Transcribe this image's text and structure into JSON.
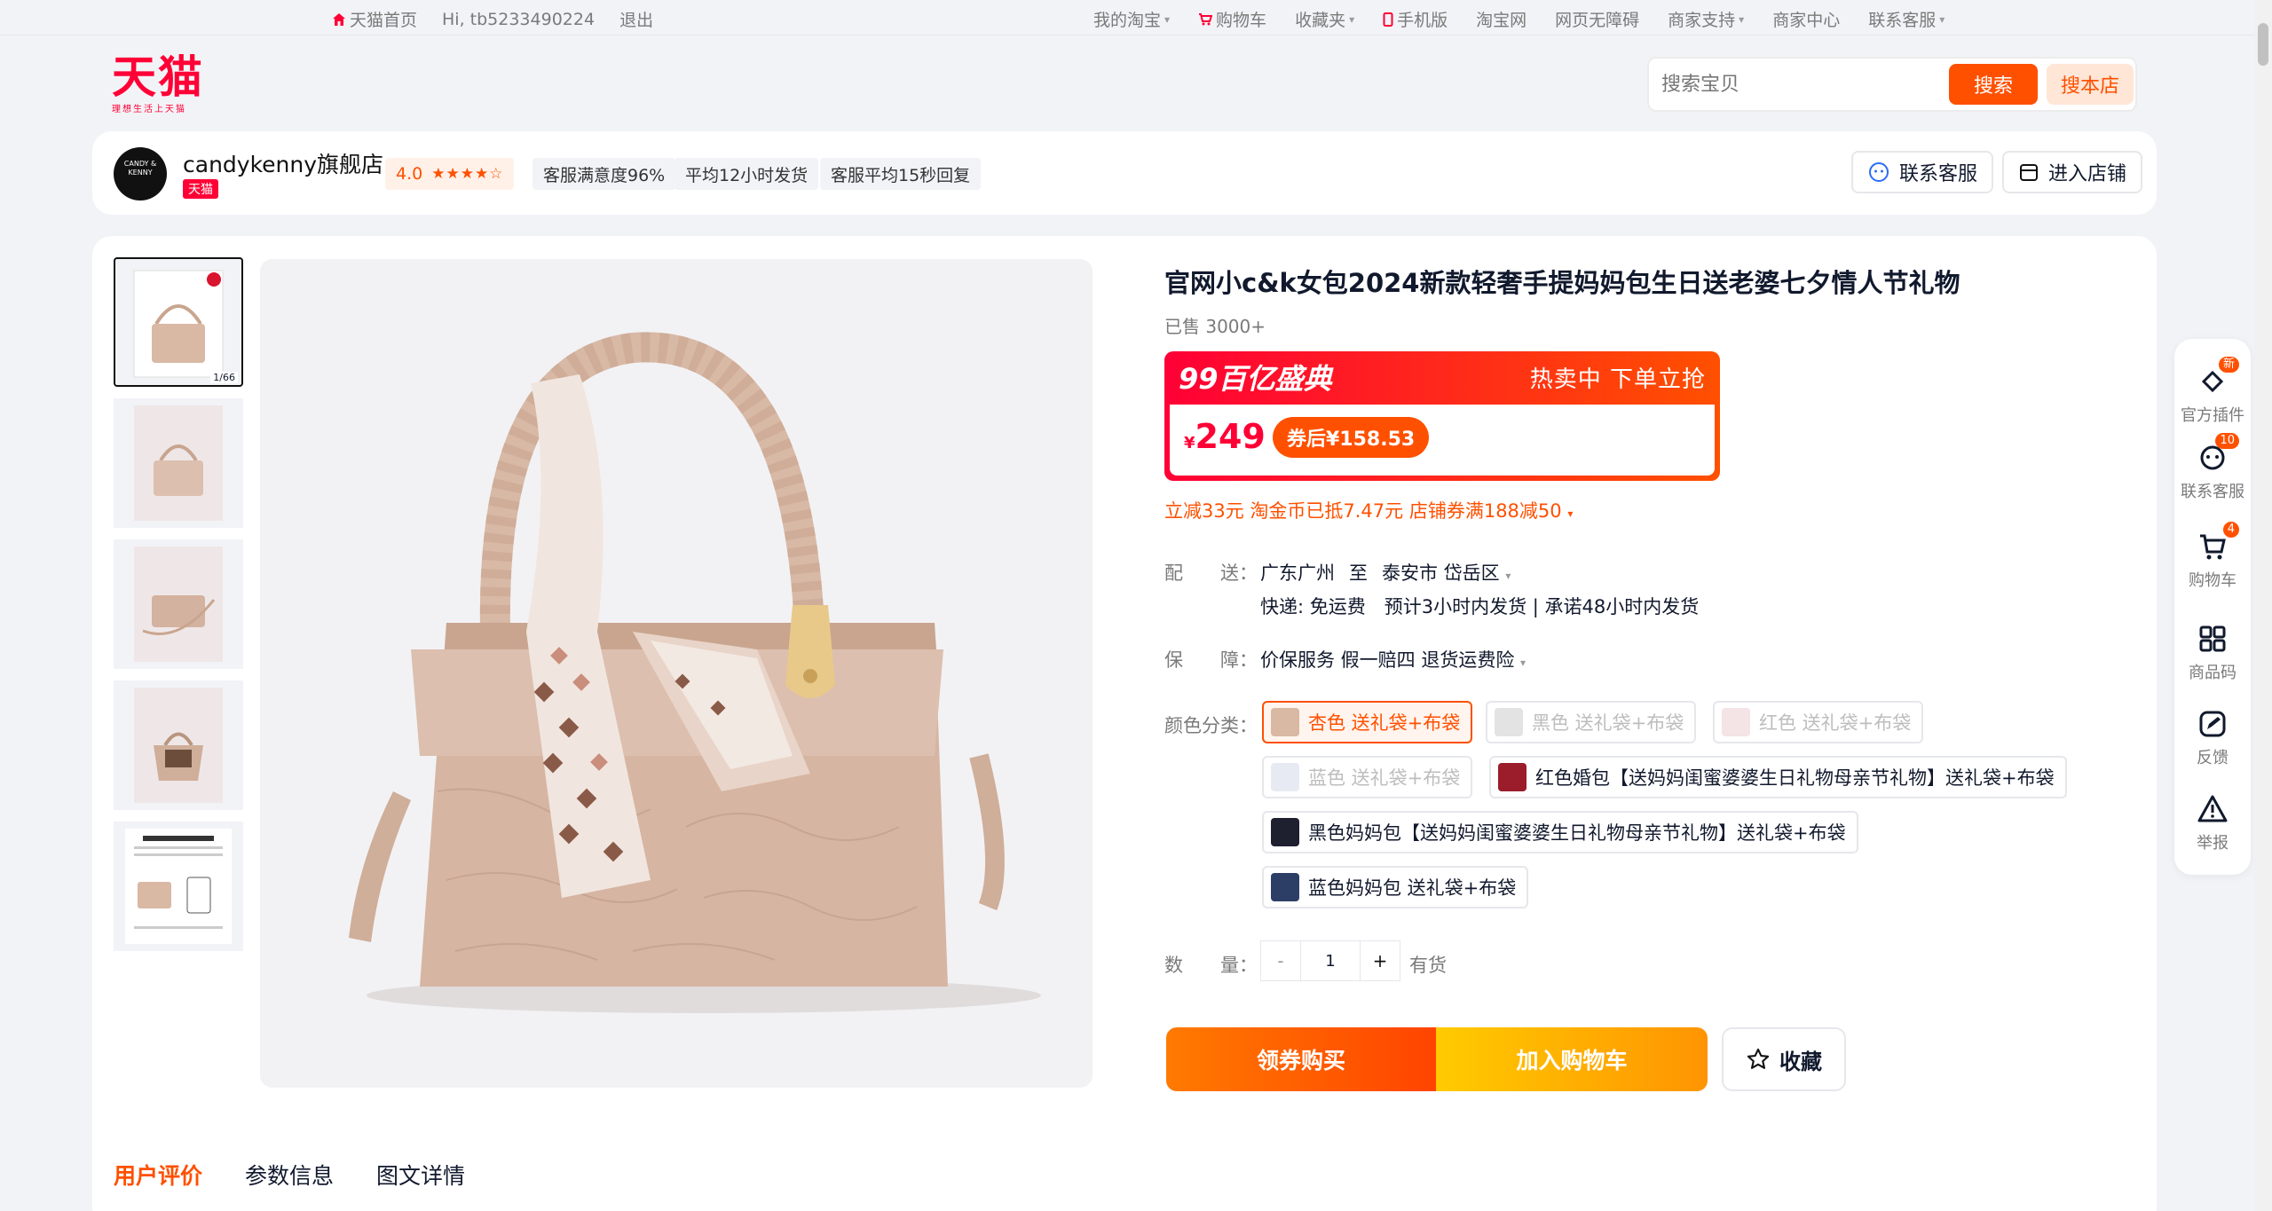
{
  "topbar": {
    "left": [
      "天猫首页",
      "Hi, tb5233490224",
      "退出"
    ],
    "right": [
      {
        "label": "我的淘宝",
        "caret": true
      },
      {
        "label": "购物车",
        "caret": false
      },
      {
        "label": "收藏夹",
        "caret": true
      },
      {
        "label": "手机版",
        "caret": false
      },
      {
        "label": "淘宝网",
        "caret": false
      },
      {
        "label": "网页无障碍",
        "caret": false
      },
      {
        "label": "商家支持",
        "caret": true
      },
      {
        "label": "商家中心",
        "caret": false
      },
      {
        "label": "联系客服",
        "caret": true
      }
    ]
  },
  "logo": {
    "text": "天猫",
    "slogan": "理想生活上天猫"
  },
  "search": {
    "placeholder": "搜索宝贝",
    "btn_search": "搜索",
    "btn_shop": "搜本店"
  },
  "shop": {
    "avatar_text": "CANDY & KENNY",
    "name": "candykenny旗舰店",
    "badge": "天猫",
    "rating": "4.0",
    "stars": "★★★★☆",
    "tags": [
      "客服满意度96%",
      "平均12小时发货",
      "客服平均15秒回复"
    ],
    "btn_service": "联系客服",
    "btn_enter": "进入店铺"
  },
  "thumbs": {
    "count_label": "1/66"
  },
  "product": {
    "title": "官网小c&k女包2024新款轻奢手提妈妈包生日送老婆七夕情人节礼物",
    "sold": "已售 3000+",
    "promo_title": "99百亿盛典",
    "promo_right": "热卖中 下单立抢",
    "yen": "¥",
    "price": "249",
    "coupon_price": "券后¥158.53",
    "discounts": "立减33元 淘金币已抵7.47元 店铺券满188减50"
  },
  "delivery": {
    "label": "配　　送：",
    "from": "广东广州",
    "to_word": "至",
    "to": "泰安市 岱岳区",
    "detail": "快递: 免运费　预计3小时内发货 | 承诺48小时内发货"
  },
  "guarantee": {
    "label": "保　　障：",
    "value": "价保服务 假一赔四 退货运费险"
  },
  "colors": {
    "label": "颜色分类：",
    "options": [
      {
        "label": "杏色 送礼袋+布袋",
        "state": "selected",
        "tint": "#d9b8a4"
      },
      {
        "label": "黑色 送礼袋+布袋",
        "state": "disabled",
        "tint": "#333333"
      },
      {
        "label": "红色 送礼袋+布袋",
        "state": "disabled",
        "tint": "#b8323b"
      },
      {
        "label": "蓝色 送礼袋+布袋",
        "state": "disabled",
        "tint": "#4a5f8a"
      },
      {
        "label": "红色婚包【送妈妈闺蜜婆婆生日礼物母亲节礼物】送礼袋+布袋",
        "state": "normal",
        "tint": "#9b1c2a"
      },
      {
        "label": "黑色妈妈包【送妈妈闺蜜婆婆生日礼物母亲节礼物】送礼袋+布袋",
        "state": "normal",
        "tint": "#1e2030"
      },
      {
        "label": "蓝色妈妈包 送礼袋+布袋",
        "state": "normal",
        "tint": "#2d3e66"
      }
    ]
  },
  "quantity": {
    "label": "数　　量：",
    "minus": "-",
    "value": "1",
    "plus": "+",
    "stock": "有货"
  },
  "actions": {
    "buy": "领券购买",
    "cart": "加入购物车",
    "fav": "收藏"
  },
  "tabs": [
    "用户评价",
    "参数信息",
    "图文详情"
  ],
  "float": [
    {
      "label": "官方插件",
      "badge": "新",
      "icon": "plugin-icon"
    },
    {
      "label": "联系客服",
      "badge": "10",
      "icon": "service-icon"
    },
    {
      "label": "购物车",
      "badge": "4",
      "icon": "cart-icon"
    },
    {
      "label": "商品码",
      "badge": "",
      "icon": "qrcode-icon"
    },
    {
      "label": "反馈",
      "badge": "",
      "icon": "feedback-icon"
    },
    {
      "label": "举报",
      "badge": "",
      "icon": "report-icon"
    }
  ],
  "colors_theme": {
    "accent": "#ff5000",
    "brand": "#ff0036"
  }
}
